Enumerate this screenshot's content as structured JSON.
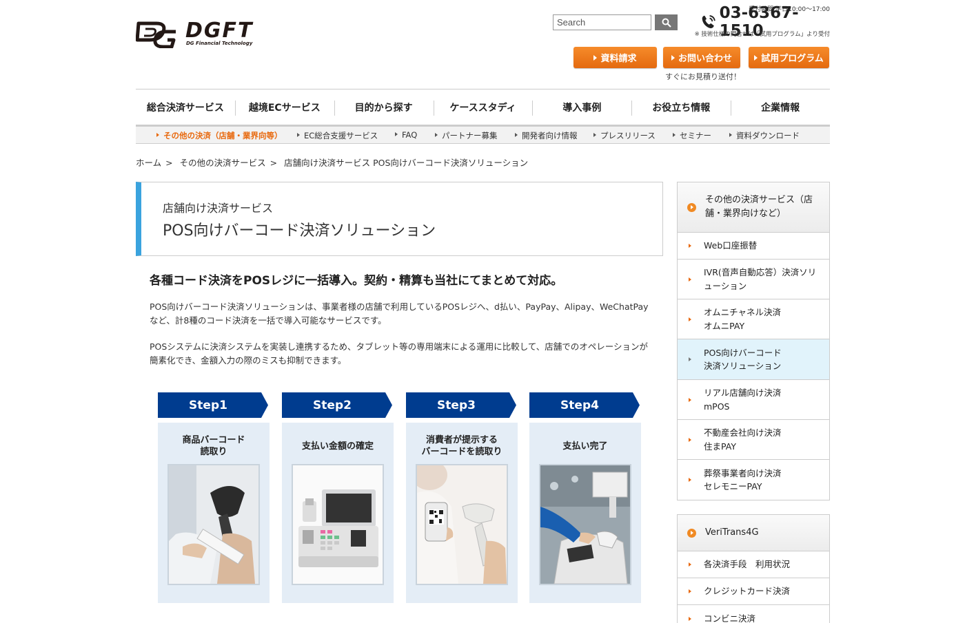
{
  "brand": {
    "name": "DGFT",
    "tagline": "DG Financial Technology"
  },
  "search": {
    "placeholder": "Search"
  },
  "contact": {
    "hours": "受付時間 平日10:00～17:00",
    "phone": "03-6367-1510",
    "note": "※ 技術仕様の問合せは「試用プログラム」より受付"
  },
  "cta": {
    "request_docs": "資料請求",
    "inquiry": "お問い合わせ",
    "trial": "試用プログラム",
    "quote_note": "すぐにお見積り送付！"
  },
  "global_nav": [
    "総合決済サービス",
    "越境ECサービス",
    "目的から探す",
    "ケーススタディ",
    "導入事例",
    "お役立ち情報",
    "企業情報"
  ],
  "sub_nav": [
    "その他の決済（店舗・業界向等）",
    "EC総合支援サービス",
    "FAQ",
    "パートナー募集",
    "開発者向け情報",
    "プレスリリース",
    "セミナー",
    "資料ダウンロード"
  ],
  "breadcrumb": [
    "ホーム",
    "その他の決済サービス",
    "店舗向け決済サービス POS向けバーコード決済ソリューション"
  ],
  "page": {
    "category": "店舗向け決済サービス",
    "title": "POS向けバーコード決済ソリューション",
    "headline": "各種コード決済をPOSレジに一括導入。契約・精算も当社にてまとめて対応。",
    "paragraph1": "POS向けバーコード決済ソリューションは、事業者様の店舗で利用しているPOSレジへ、d払い、PayPay、Alipay、WeChatPayなど、計8種のコード決済を一括で導入可能なサービスです。",
    "paragraph2": "POSシステムに決済システムを実装し連携するため、タブレット等の専用端末による運用に比較して、店舗でのオペレーションが簡素化でき、金額入力の際のミスも抑制できます。"
  },
  "steps": [
    {
      "label": "Step1",
      "desc": "商品バーコード\n読取り",
      "image": "barcode-scanner-photo"
    },
    {
      "label": "Step2",
      "desc": "支払い金額の確定",
      "image": "pos-register-photo"
    },
    {
      "label": "Step3",
      "desc": "消費者が提示する\nバーコードを読取り",
      "image": "smartphone-qr-scan-photo"
    },
    {
      "label": "Step4",
      "desc": "支払い完了",
      "image": "checkout-payment-photo"
    }
  ],
  "sidebar": {
    "group1": {
      "heading": "その他の決済サービス（店舗・業界向けなど）",
      "items": [
        "Web口座振替",
        "IVR(音声自動応答）決済ソリューション",
        "オムニチャネル決済\nオムニPAY",
        "POS向けバーコード\n決済ソリューション",
        "リアル店舗向け決済\nmPOS",
        "不動産会社向け決済\n住まPAY",
        "葬祭事業者向け決済\nセレモニーPAY"
      ],
      "active_index": 3
    },
    "group2": {
      "heading": "VeriTrans4G",
      "items": [
        "各決済手段　利用状況",
        "クレジットカード決済",
        "コンビニ決済"
      ]
    }
  },
  "colors": {
    "accent_orange": "#e8690e",
    "step_blue": "#003c8f",
    "title_bar_blue": "#3aa3de"
  }
}
